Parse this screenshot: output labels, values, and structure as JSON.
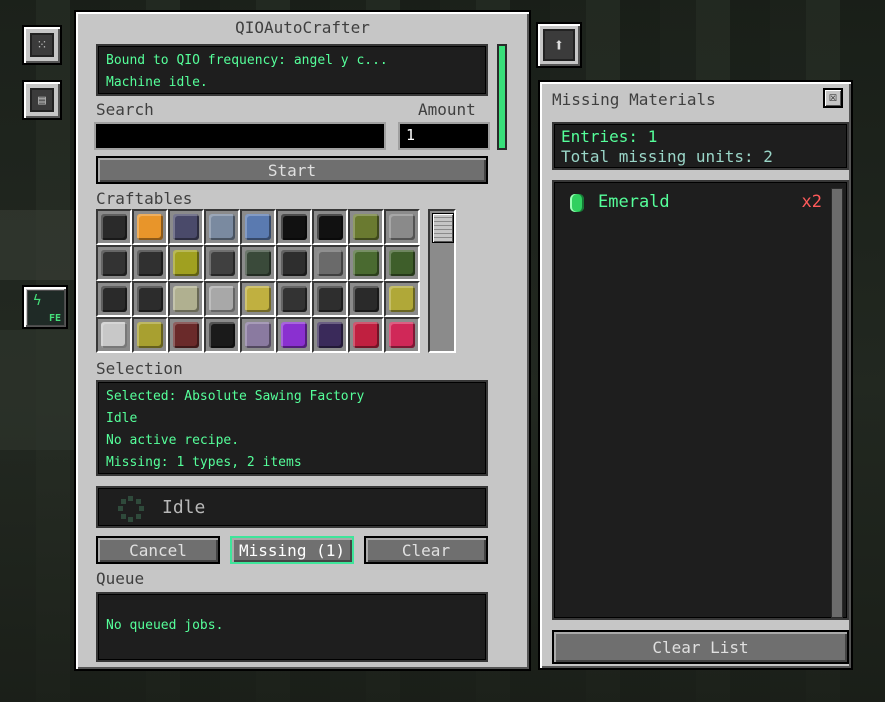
{
  "window": {
    "title": "QIOAutoCrafter",
    "status_lines": [
      "Bound to QIO frequency: angel y c...",
      "Machine idle."
    ]
  },
  "search": {
    "label": "Search",
    "value": ""
  },
  "amount": {
    "label": "Amount",
    "value": "1"
  },
  "start_label": "Start",
  "craftables": {
    "label": "Craftables",
    "items": [
      {
        "icon": "black-block",
        "color": "#2a2a2a"
      },
      {
        "icon": "orange-orb",
        "color": "#e8952a"
      },
      {
        "icon": "machine-purple",
        "color": "#4a4a6a"
      },
      {
        "icon": "scope-blue",
        "color": "#7a8aa0"
      },
      {
        "icon": "laser-blue",
        "color": "#5a7ab0"
      },
      {
        "icon": "black-panel",
        "color": "#111111"
      },
      {
        "icon": "black-panel",
        "color": "#111111"
      },
      {
        "icon": "yellow-block",
        "color": "#6a7a30"
      },
      {
        "icon": "gray-block",
        "color": "#8a8a8a"
      },
      {
        "icon": "factory-black",
        "color": "#333333"
      },
      {
        "icon": "factory-black",
        "color": "#303030"
      },
      {
        "icon": "yellow-core",
        "color": "#a0a020"
      },
      {
        "icon": "factory-gray",
        "color": "#404040"
      },
      {
        "icon": "factory-green",
        "color": "#3a4a3a"
      },
      {
        "icon": "factory-black",
        "color": "#2e2e2e"
      },
      {
        "icon": "gray-pillar",
        "color": "#6a6a6a"
      },
      {
        "icon": "green-block",
        "color": "#4a6a30"
      },
      {
        "icon": "green-block",
        "color": "#3e5e2a"
      },
      {
        "icon": "factory-black",
        "color": "#2a2a2a"
      },
      {
        "icon": "factory-black",
        "color": "#2c2c2c"
      },
      {
        "icon": "pale-block",
        "color": "#b0b090"
      },
      {
        "icon": "pale-block",
        "color": "#a8a8a8"
      },
      {
        "icon": "yellow-cubes",
        "color": "#c0b040"
      },
      {
        "icon": "factory-black",
        "color": "#333333"
      },
      {
        "icon": "factory-black",
        "color": "#2e2e2e"
      },
      {
        "icon": "factory-black",
        "color": "#2a2a2a"
      },
      {
        "icon": "yellow-cubes",
        "color": "#b0a838"
      },
      {
        "icon": "white-robot",
        "color": "#c8c8c8"
      },
      {
        "icon": "yellow-cubes",
        "color": "#a8a030"
      },
      {
        "icon": "red-block",
        "color": "#6a2a2a"
      },
      {
        "icon": "black-hat",
        "color": "#1a1a1a"
      },
      {
        "icon": "purple-orb",
        "color": "#8a7aa0"
      },
      {
        "icon": "purple-heart",
        "color": "#8a30d0"
      },
      {
        "icon": "dark-orb",
        "color": "#3a2a5a"
      },
      {
        "icon": "red-crab",
        "color": "#c02040"
      },
      {
        "icon": "red-crab",
        "color": "#d02858"
      }
    ]
  },
  "selection": {
    "label": "Selection",
    "lines": [
      "Selected: Absolute Sawing Factory",
      "Idle",
      "No active recipe.",
      "Missing: 1 types, 2 items"
    ]
  },
  "idle_status": "Idle",
  "buttons": {
    "cancel": "Cancel",
    "missing": "Missing (1)",
    "clear": "Clear"
  },
  "queue": {
    "label": "Queue",
    "empty_text": "No queued jobs."
  },
  "missing_panel": {
    "title": "Missing Materials",
    "close": "☒",
    "entries": "Entries: 1",
    "total": "Total missing units: 2",
    "items": [
      {
        "name": "Emerald",
        "count": "x2",
        "icon": "emerald-icon"
      }
    ],
    "clear_list": "Clear List"
  },
  "colors": {
    "accent": "#55ff9a",
    "warning": "#ff5a5a",
    "panel": "#c6c6c6"
  }
}
